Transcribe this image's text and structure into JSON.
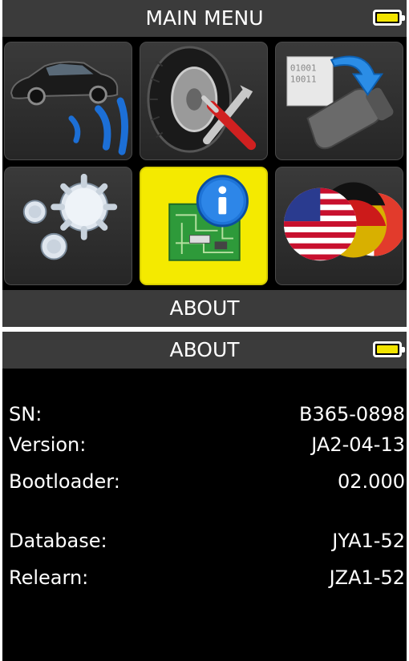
{
  "main_menu": {
    "title": "MAIN MENU",
    "footer_label": "ABOUT",
    "battery": {
      "level": 1.0,
      "icon": "battery-icon",
      "fill_color": "#f2e400"
    },
    "tiles": [
      {
        "id": "activate",
        "icon": "car-sensor-signal-icon",
        "selected": false
      },
      {
        "id": "service",
        "icon": "tire-tools-icon",
        "selected": false
      },
      {
        "id": "program",
        "icon": "sensor-download-icon",
        "selected": false
      },
      {
        "id": "settings",
        "icon": "gears-icon",
        "selected": false
      },
      {
        "id": "about",
        "icon": "info-circuit-icon",
        "selected": true
      },
      {
        "id": "language",
        "icon": "flags-icon",
        "selected": false
      }
    ],
    "selected_color": "#f4ea00"
  },
  "about": {
    "title": "ABOUT",
    "battery": {
      "level": 1.0,
      "icon": "battery-icon"
    },
    "fields": [
      {
        "label": "SN:",
        "value": "B365-0898"
      },
      {
        "label": "Version:",
        "value": "JA2-04-13"
      },
      {
        "label": "Bootloader:",
        "value": "02.000"
      },
      {
        "label": "Database:",
        "value": "JYA1-52"
      },
      {
        "label": "Relearn:",
        "value": "JZA1-52"
      }
    ]
  }
}
